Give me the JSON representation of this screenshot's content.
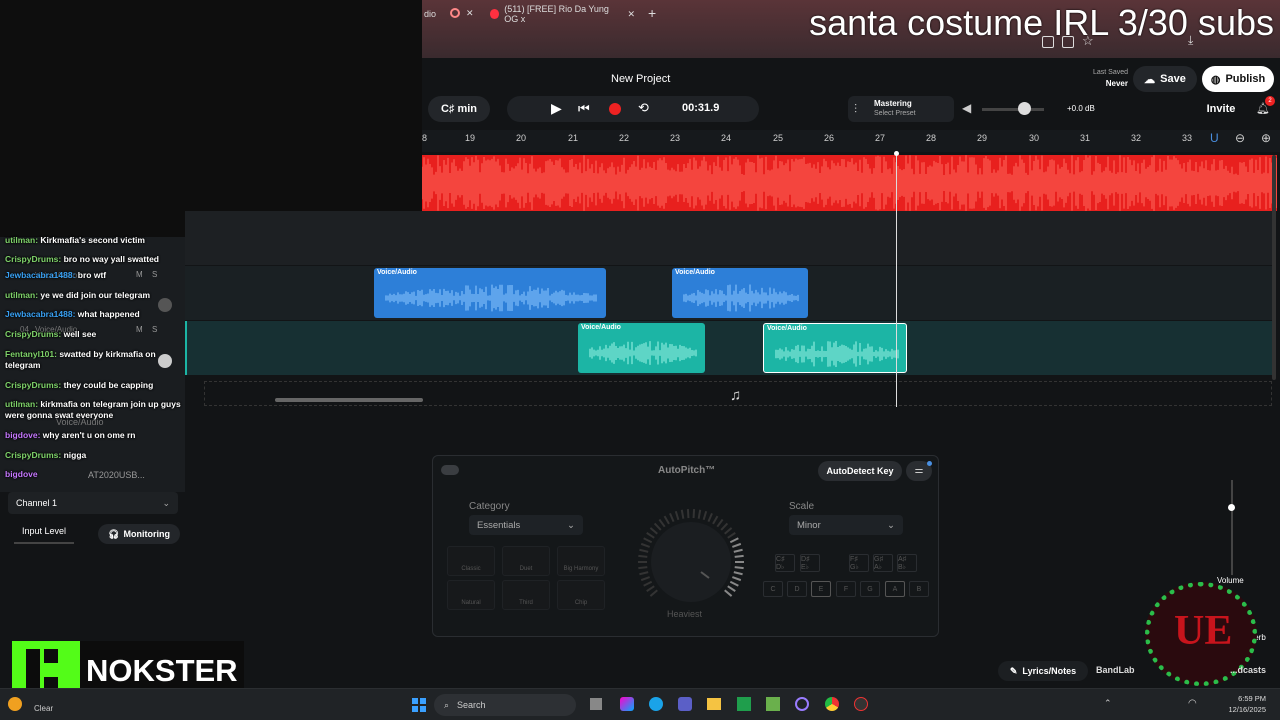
{
  "browser": {
    "tab1_label": "dio",
    "tab2_label": "(511) [FREE] Rio Da Yung OG x",
    "new_tab": "+"
  },
  "stream_overlay": {
    "title": "santa costume IRL 3/30 subs",
    "nokster_label": "NOKSTER"
  },
  "header": {
    "project_name": "New Project",
    "last_saved_label": "Last Saved",
    "last_saved_value": "Never",
    "save_label": "Save",
    "publish_label": "Publish",
    "invite_label": "Invite",
    "notif_count": "2"
  },
  "transport": {
    "key": "C♯ min",
    "time": "00:31.9",
    "mastering_label": "Mastering",
    "mastering_preset": "Select Preset",
    "volume_db": "+0.0 dB"
  },
  "ruler": {
    "bars": [
      "8",
      "19",
      "20",
      "21",
      "22",
      "23",
      "24",
      "25",
      "26",
      "27",
      "28",
      "29",
      "30",
      "31",
      "32",
      "33"
    ]
  },
  "tracks": {
    "clip_label": "Voice/Audio",
    "track_a_name": "Voice/Audio",
    "track_b_num": "04",
    "track_b_name": "Voice/Audio",
    "track_c_name": "Voice/Audio",
    "mute": "M",
    "solo": "S",
    "input_device": "AT2020USB...",
    "channel": "Channel 1",
    "input_level": "Input Level",
    "monitoring": "Monitoring"
  },
  "chat": [
    {
      "user": "utilman",
      "msg": "Kirkmafia's second victim",
      "color": "u"
    },
    {
      "user": "CrispyDrums",
      "msg": "bro no way yall swatted",
      "color": "u"
    },
    {
      "user": "Jewbacabra1488",
      "msg": "bro wtf",
      "color": "u2"
    },
    {
      "user": "utilman",
      "msg": "ye we did join our telegram",
      "color": "u"
    },
    {
      "user": "Jewbacabra1488",
      "msg": "what happened",
      "color": "u2"
    },
    {
      "user": "CrispyDrums",
      "msg": "well see",
      "color": "u"
    },
    {
      "user": "Fentanyl101",
      "msg": "swatted by kirkmafia on telegram",
      "color": "u"
    },
    {
      "user": "CrispyDrums",
      "msg": "they could be capping",
      "color": "u"
    },
    {
      "user": "utilman",
      "msg": "kirkmafia on telegram join up guys were gonna swat everyone",
      "color": "u"
    },
    {
      "user": "bigdove",
      "msg": "why aren't u on ome rn",
      "color": "u3"
    },
    {
      "user": "CrispyDrums",
      "msg": "nigga",
      "color": "u"
    },
    {
      "user": "bigdove",
      "msg": "",
      "color": "u3"
    }
  ],
  "autopitch": {
    "title": "AutoPitch™",
    "autodetect": "AutoDetect Key",
    "category_label": "Category",
    "category_value": "Essentials",
    "scale_label": "Scale",
    "scale_value": "Minor",
    "knob_label": "Heaviest",
    "presets": [
      "Classic",
      "Duet",
      "Big Harmony",
      "Natural",
      "Third",
      "Chip"
    ],
    "keys_top": [
      "C♯ D♭",
      "D♯ E♭",
      "F♯ G♭",
      "G♯ A♭",
      "A♯ B♭"
    ],
    "keys_bottom": [
      "C",
      "D",
      "E",
      "F",
      "G",
      "A",
      "B"
    ]
  },
  "right_panel": {
    "volume_label": "Volume",
    "reverb_label": "Reverb"
  },
  "bottom_bar": {
    "lyrics": "Lyrics/Notes",
    "bandlab": "BandLab",
    "podcasts": "...dcasts"
  },
  "taskbar": {
    "search_placeholder": "Search",
    "weather": "Clear",
    "time": "6:59 PM",
    "date": "12/16/2025"
  },
  "colors": {
    "red_track": "#e8201e",
    "blue_clip": "#2d7fd8",
    "teal_clip": "#1cb5a5",
    "accent": "#4a90e2"
  }
}
